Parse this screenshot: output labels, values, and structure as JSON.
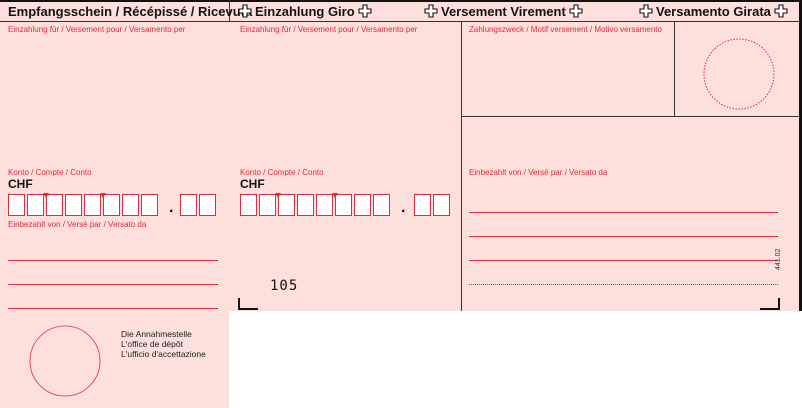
{
  "header": {
    "receipt_title": "Empfangsschein / Récépissé / Ricevuta",
    "payment_title_de": "Einzahlung Giro",
    "payment_title_fr": "Versement Virement",
    "payment_title_it": "Versamento Girata"
  },
  "receipt": {
    "payable_to_label": "Einzahlung für / Versement pour / Versamento per",
    "account_label": "Konto / Compte / Conto",
    "currency": "CHF",
    "paid_by_label": "Einbezahlt von / Versé par / Versato da",
    "acceptance_office": [
      "Die Annahmestelle",
      "L'office de dépôt",
      "L'ufficio d'accettazione"
    ]
  },
  "payment": {
    "payable_to_label": "Einzahlung für / Versement pour / Versamento per",
    "account_label": "Konto / Compte / Conto",
    "currency": "CHF",
    "form_code": "105",
    "purpose_label": "Zahlungszweck / Motif versement / Motivo versamento",
    "paid_by_label": "Einbezahlt von / Versé par / Versato da",
    "form_number": "441.02"
  },
  "colors": {
    "form_background": "#fde0dc",
    "form_red": "#e6283c",
    "text": "#111111"
  }
}
